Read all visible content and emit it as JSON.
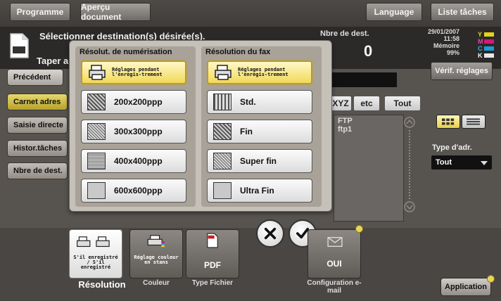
{
  "topbar": {
    "programme": "Programme",
    "apercu": "Aperçu document",
    "language": "Language",
    "liste_taches": "Liste tâches"
  },
  "message": {
    "select_dest": "Sélectionner destination(s) désirée(s).",
    "taper": "Taper a"
  },
  "destinations": {
    "label": "Nbre de dest.",
    "value": "0"
  },
  "status": {
    "date": "29/01/2007",
    "time": "11:58",
    "memory_label": "Mémoire",
    "memory_value": "99%",
    "toner_letters": [
      "Y",
      "M",
      "C",
      "K"
    ],
    "toner_colors": [
      "#e5d31a",
      "#d2187a",
      "#1c9bd9",
      "#111111"
    ]
  },
  "verif_button": "Vérif. réglages",
  "left_tabs": [
    "Précédent",
    "Carnet adres",
    "Saisie directe",
    "Histor.tâches",
    "Nbre de dest."
  ],
  "abc_tabs": [
    "XYZ",
    "etc",
    "Tout"
  ],
  "address_list": {
    "item_type": "FTP",
    "item_name": "ftp1"
  },
  "type_adr": {
    "label": "Type d'adr.",
    "value": "Tout"
  },
  "modal": {
    "scan_title": "Résolut. de numérisation",
    "fax_title": "Résolution du fax",
    "scan_options": [
      "Réglages pendant l'enregis-trement",
      "200x200ppp",
      "300x300ppp",
      "400x400ppp",
      "600x600ppp"
    ],
    "fax_options": [
      "Réglages pendant l'enregis-trement",
      "Std.",
      "Fin",
      "Super fin",
      "Ultra Fin"
    ],
    "scan_selected_index": 0,
    "fax_selected_index": 0
  },
  "bottom_tiles": [
    {
      "label": "Résolution",
      "text": "S'il enregistré / S'il enregistré"
    },
    {
      "label": "Couleur",
      "text": "Réglage couleur en stans"
    },
    {
      "label": "Type Fichier",
      "text": "PDF"
    },
    {
      "label": "Configuration e-mail",
      "text": "OUI"
    }
  ],
  "application_button": "Application",
  "icons": {
    "cancel": "close-icon",
    "ok": "check-icon"
  }
}
